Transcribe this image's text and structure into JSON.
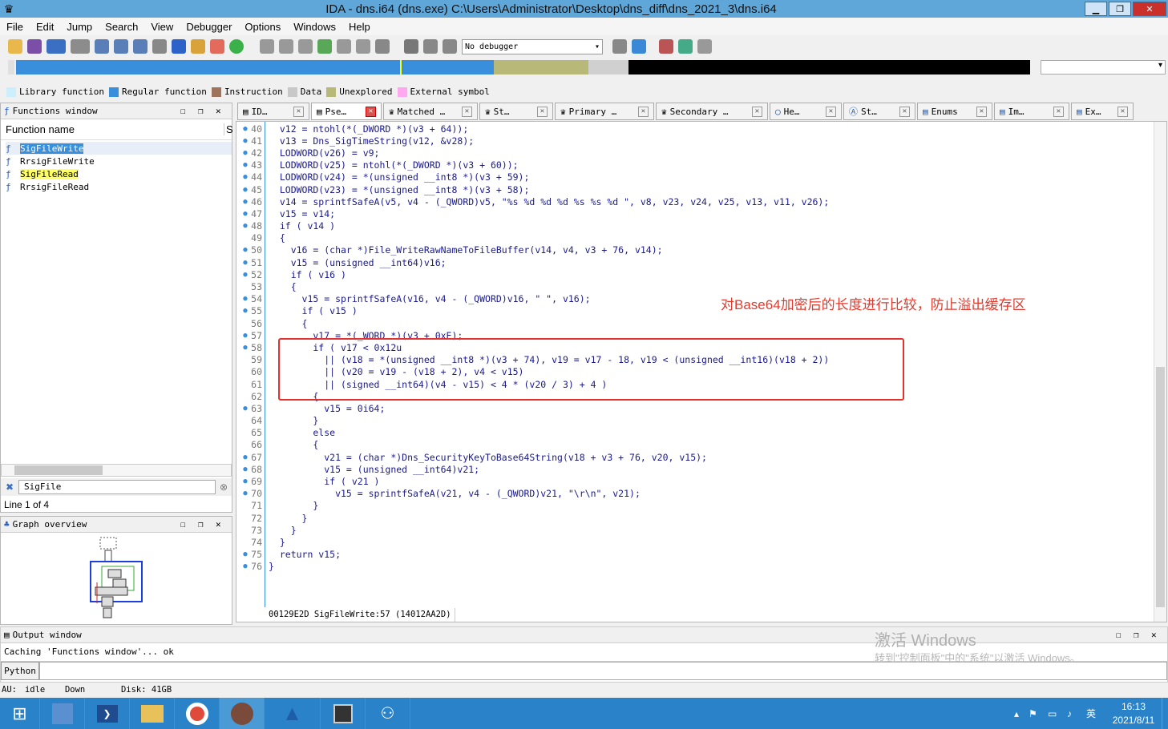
{
  "window": {
    "title": "IDA - dns.i64 (dns.exe) C:\\Users\\Administrator\\Desktop\\dns_diff\\dns_2021_3\\dns.i64",
    "min": "▁",
    "max": "❐",
    "close": "✕"
  },
  "menu": [
    "File",
    "Edit",
    "Jump",
    "Search",
    "View",
    "Debugger",
    "Options",
    "Windows",
    "Help"
  ],
  "toolbar": {
    "debugger_value": "No debugger"
  },
  "legend": [
    {
      "label": "Library function",
      "color": "#cdeffd"
    },
    {
      "label": "Regular function",
      "color": "#3a8fdc"
    },
    {
      "label": "Instruction",
      "color": "#a0745a"
    },
    {
      "label": "Data",
      "color": "#c8c8c8"
    },
    {
      "label": "Unexplored",
      "color": "#b8b878"
    },
    {
      "label": "External symbol",
      "color": "#ffa8f0"
    }
  ],
  "functions_window": {
    "title": "Functions window",
    "column": "Function name",
    "column2": "S",
    "items": [
      "SigFileWrite",
      "RrsigFileWrite",
      "SigFileRead",
      "RrsigFileRead"
    ],
    "search": "SigFile",
    "status": "Line 1 of 4"
  },
  "graph_overview": {
    "title": "Graph overview"
  },
  "tabs": [
    {
      "label": "ID…",
      "active": false
    },
    {
      "label": "Pse…",
      "active": true
    },
    {
      "label": "Matched …",
      "active": false
    },
    {
      "label": "St…",
      "active": false
    },
    {
      "label": "Primary …",
      "active": false
    },
    {
      "label": "Secondary …",
      "active": false
    },
    {
      "label": "He…",
      "active": false
    },
    {
      "label": "St…",
      "active": false
    },
    {
      "label": "Enums",
      "active": false
    },
    {
      "label": "Im…",
      "active": false
    },
    {
      "label": "Ex…",
      "active": false
    }
  ],
  "code": [
    {
      "n": "40",
      "dot": true,
      "t": "  v12 = ntohl(*(_DWORD *)(v3 + 64));"
    },
    {
      "n": "41",
      "dot": true,
      "t": "  v13 = Dns_SigTimeString(v12, &v28);"
    },
    {
      "n": "42",
      "dot": true,
      "t": "  LODWORD(v26) = v9;"
    },
    {
      "n": "43",
      "dot": true,
      "t": "  LODWORD(v25) = ntohl(*(_DWORD *)(v3 + 60));"
    },
    {
      "n": "44",
      "dot": true,
      "t": "  LODWORD(v24) = *(unsigned __int8 *)(v3 + 59);"
    },
    {
      "n": "45",
      "dot": true,
      "t": "  LODWORD(v23) = *(unsigned __int8 *)(v3 + 58);"
    },
    {
      "n": "46",
      "dot": true,
      "t": "  v14 = sprintfSafeA(v5, v4 - (_QWORD)v5, \"%s %d %d %d %s %s %d \", v8, v23, v24, v25, v13, v11, v26);"
    },
    {
      "n": "47",
      "dot": true,
      "t": "  v15 = v14;"
    },
    {
      "n": "48",
      "dot": true,
      "t": "  if ( v14 )"
    },
    {
      "n": "49",
      "dot": false,
      "t": "  {"
    },
    {
      "n": "50",
      "dot": true,
      "t": "    v16 = (char *)File_WriteRawNameToFileBuffer(v14, v4, v3 + 76, v14);"
    },
    {
      "n": "51",
      "dot": true,
      "t": "    v15 = (unsigned __int64)v16;"
    },
    {
      "n": "52",
      "dot": true,
      "t": "    if ( v16 )"
    },
    {
      "n": "53",
      "dot": false,
      "t": "    {"
    },
    {
      "n": "54",
      "dot": true,
      "t": "      v15 = sprintfSafeA(v16, v4 - (_QWORD)v16, \" \", v16);"
    },
    {
      "n": "55",
      "dot": true,
      "t": "      if ( v15 )"
    },
    {
      "n": "56",
      "dot": false,
      "t": "      {"
    },
    {
      "n": "57",
      "dot": true,
      "t": "        v17 = *(_WORD *)(v3 + 0xE);"
    },
    {
      "n": "58",
      "dot": true,
      "t": "        if ( v17 < 0x12u"
    },
    {
      "n": "59",
      "dot": false,
      "t": "          || (v18 = *(unsigned __int8 *)(v3 + 74), v19 = v17 - 18, v19 < (unsigned __int16)(v18 + 2))"
    },
    {
      "n": "60",
      "dot": false,
      "t": "          || (v20 = v19 - (v18 + 2), v4 < v15)"
    },
    {
      "n": "61",
      "dot": false,
      "t": "          || (signed __int64)(v4 - v15) < 4 * (v20 / 3) + 4 )"
    },
    {
      "n": "62",
      "dot": false,
      "t": "        {"
    },
    {
      "n": "63",
      "dot": true,
      "t": "          v15 = 0i64;"
    },
    {
      "n": "64",
      "dot": false,
      "t": "        }"
    },
    {
      "n": "65",
      "dot": false,
      "t": "        else"
    },
    {
      "n": "66",
      "dot": false,
      "t": "        {"
    },
    {
      "n": "67",
      "dot": true,
      "t": "          v21 = (char *)Dns_SecurityKeyToBase64String(v18 + v3 + 76, v20, v15);"
    },
    {
      "n": "68",
      "dot": true,
      "t": "          v15 = (unsigned __int64)v21;"
    },
    {
      "n": "69",
      "dot": true,
      "t": "          if ( v21 )"
    },
    {
      "n": "70",
      "dot": true,
      "t": "            v15 = sprintfSafeA(v21, v4 - (_QWORD)v21, \"\\r\\n\", v21);"
    },
    {
      "n": "71",
      "dot": false,
      "t": "        }"
    },
    {
      "n": "72",
      "dot": false,
      "t": "      }"
    },
    {
      "n": "73",
      "dot": false,
      "t": "    }"
    },
    {
      "n": "74",
      "dot": false,
      "t": "  }"
    },
    {
      "n": "75",
      "dot": true,
      "t": "  return v15;"
    },
    {
      "n": "76",
      "dot": true,
      "t": "}"
    }
  ],
  "annotation": "对Base64加密后的长度进行比较，防止溢出缓存区",
  "code_status": "00129E2D SigFileWrite:57 (14012AA2D)",
  "output": {
    "title": "Output window",
    "line": "Caching 'Functions window'... ok",
    "prompt": "Python"
  },
  "watermark": {
    "line1": "激活 Windows",
    "line2": "转到\"控制面板\"中的\"系统\"以激活 Windows。"
  },
  "statusbar": {
    "au": "AU:",
    "state": "idle",
    "dir": "Down",
    "disk": "Disk: 41GB"
  },
  "taskbar": {
    "time": "16:13",
    "date": "2021/8/11",
    "lang": "英"
  }
}
